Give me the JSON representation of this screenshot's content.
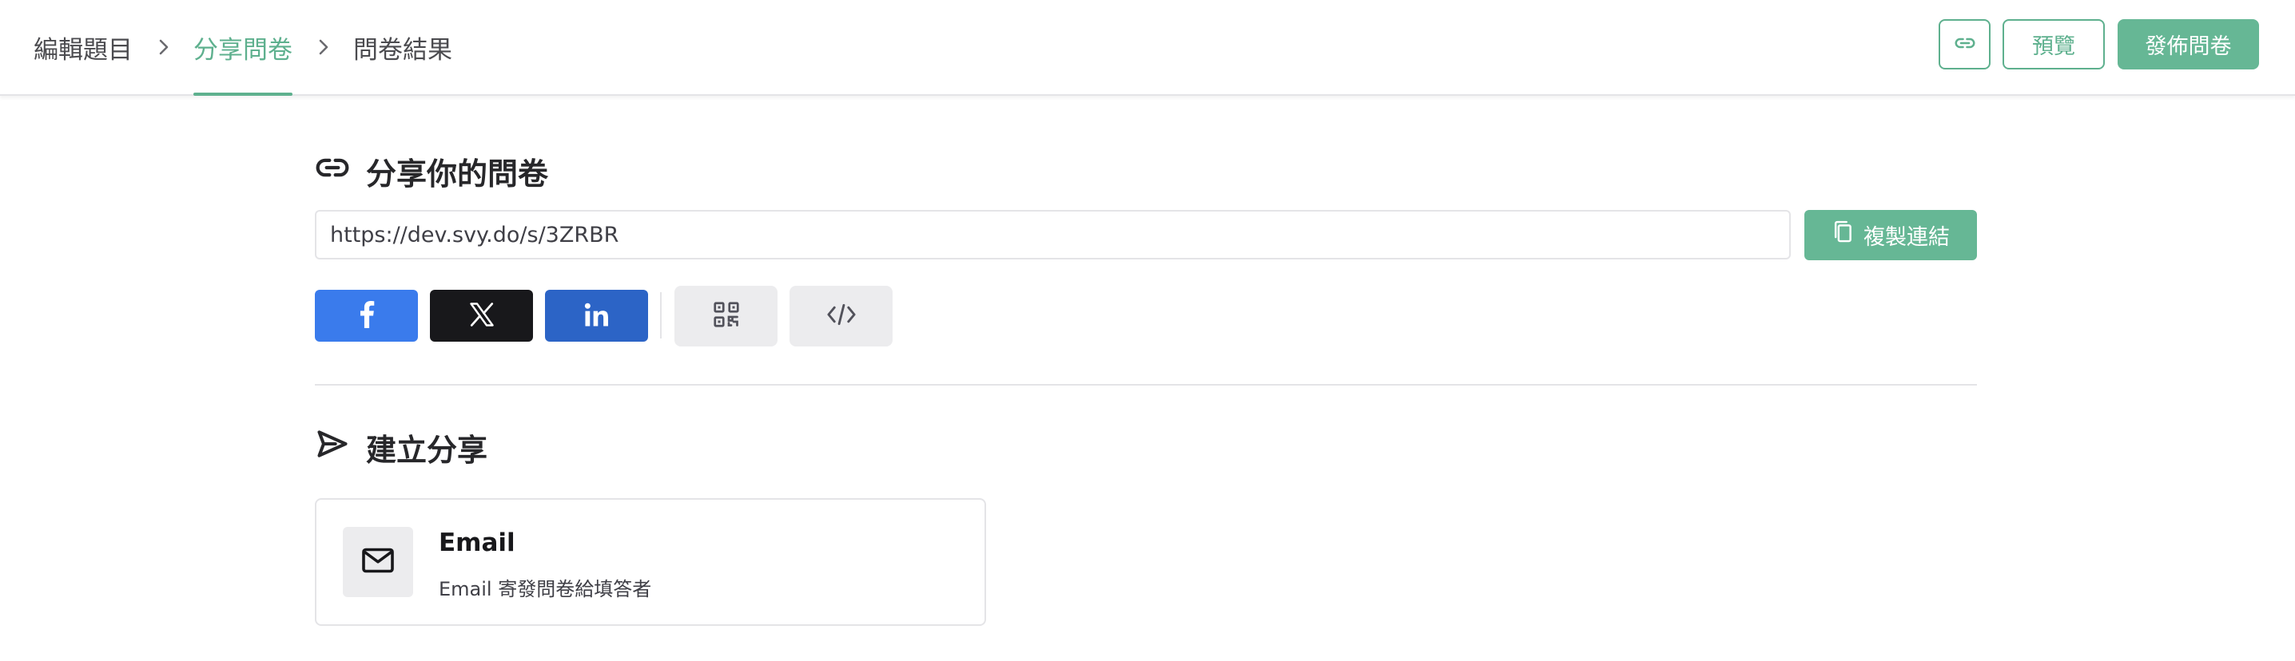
{
  "breadcrumb": [
    {
      "label": "編輯題目",
      "active": false
    },
    {
      "label": "分享問卷",
      "active": true
    },
    {
      "label": "問卷結果",
      "active": false
    }
  ],
  "header": {
    "link_icon": "link-icon",
    "preview_label": "預覽",
    "publish_label": "發佈問卷"
  },
  "share_section": {
    "icon": "link-icon",
    "title": "分享你的問卷",
    "url": "https://dev.svy.do/s/3ZRBR",
    "copy_icon": "copy-icon",
    "copy_label": "複製連結",
    "social": [
      {
        "name": "facebook",
        "icon": "facebook-icon",
        "color": "#3a7bec"
      },
      {
        "name": "x",
        "icon": "x-icon",
        "color": "#18181b"
      },
      {
        "name": "linkedin",
        "icon": "linkedin-icon",
        "color": "#2c64c6"
      }
    ],
    "tools": [
      {
        "name": "qr-code",
        "icon": "qr-code-icon"
      },
      {
        "name": "embed",
        "icon": "code-icon"
      }
    ]
  },
  "create_section": {
    "icon": "send-icon",
    "title": "建立分享",
    "cards": [
      {
        "icon": "mail-icon",
        "title": "Email",
        "description": "Email 寄發問卷給填答者"
      }
    ]
  },
  "colors": {
    "accent": "#5eb08e",
    "accent_fill": "#66b795",
    "facebook": "#3a7bec",
    "x": "#18181b",
    "linkedin": "#2c64c6"
  }
}
